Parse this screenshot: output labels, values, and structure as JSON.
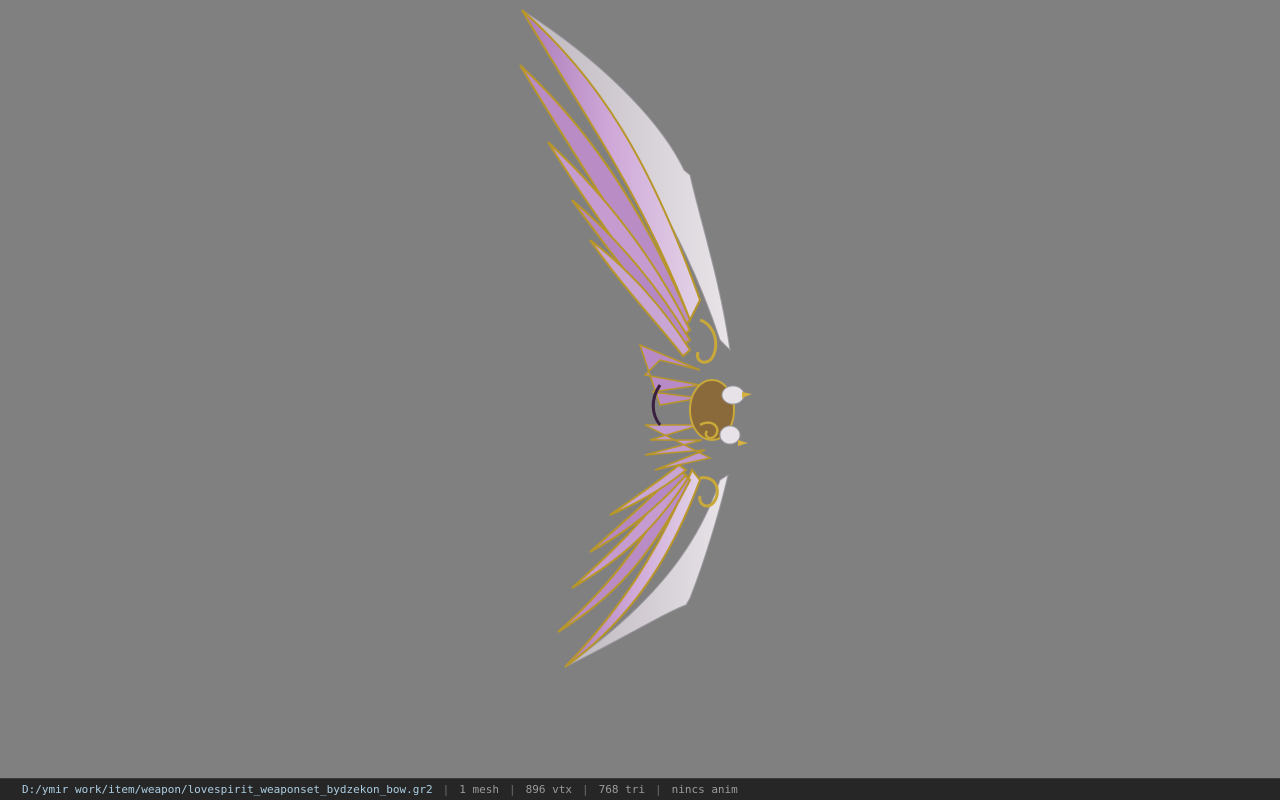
{
  "viewport": {
    "background_color": "#808080",
    "model": "bow-wings-model"
  },
  "status_bar": {
    "file_path": "D:/ymir work/item/weapon/lovespirit_weaponset_bydzekon_bow.gr2",
    "separator": "|",
    "mesh_count": "1 mesh",
    "vertex_count": "896 vtx",
    "triangle_count": "768 tri",
    "animation": "nincs anim"
  },
  "colors": {
    "feather_light": "#c8a0d0",
    "feather_dark": "#9a6aa8",
    "gold_trim": "#b8962a",
    "white_edge": "#d8d4d8",
    "status_bg": "#262626"
  }
}
